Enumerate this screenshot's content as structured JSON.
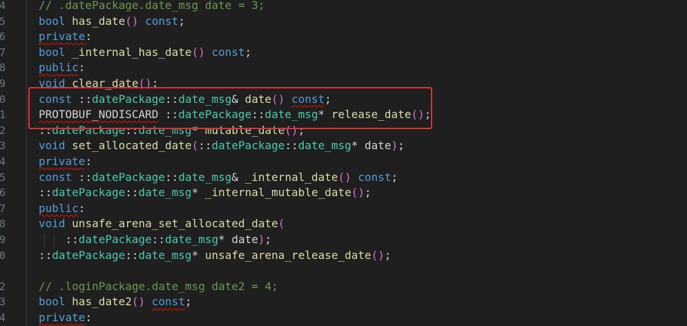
{
  "gutter": [
    "4",
    "5",
    "6",
    "7",
    "8",
    "9",
    "0",
    "1",
    "2",
    "3",
    "4",
    "5",
    "6",
    "7",
    "8",
    "9",
    "0",
    "",
    "2",
    "3",
    "4"
  ],
  "lines": [
    [
      {
        "c": "cm",
        "t": "// .datePackage.date_msg date = 3;"
      }
    ],
    [
      {
        "c": "kw",
        "t": "bool"
      },
      {
        "c": "pl",
        "t": " "
      },
      {
        "c": "fn",
        "t": "has_date"
      },
      {
        "c": "br",
        "t": "()"
      },
      {
        "c": "pl",
        "t": " "
      },
      {
        "c": "kw",
        "t": "const"
      },
      {
        "c": "pl",
        "t": ";"
      }
    ],
    [
      {
        "c": "kw sq",
        "t": "private"
      },
      {
        "c": "pl",
        "t": ":"
      }
    ],
    [
      {
        "c": "kw",
        "t": "bool"
      },
      {
        "c": "pl",
        "t": " "
      },
      {
        "c": "fn",
        "t": "_internal_has_date"
      },
      {
        "c": "br",
        "t": "()"
      },
      {
        "c": "pl",
        "t": " "
      },
      {
        "c": "kw",
        "t": "const"
      },
      {
        "c": "pl",
        "t": ";"
      }
    ],
    [
      {
        "c": "kw sq",
        "t": "public"
      },
      {
        "c": "pl",
        "t": ":"
      }
    ],
    [
      {
        "c": "kw",
        "t": "void"
      },
      {
        "c": "pl",
        "t": " "
      },
      {
        "c": "fn",
        "t": "clear_date"
      },
      {
        "c": "br",
        "t": "()"
      },
      {
        "c": "pl",
        "t": ";"
      }
    ],
    [
      {
        "c": "kw",
        "t": "const"
      },
      {
        "c": "pl",
        "t": " ::"
      },
      {
        "c": "ns",
        "t": "datePackage"
      },
      {
        "c": "pl",
        "t": "::"
      },
      {
        "c": "ns",
        "t": "date_msg"
      },
      {
        "c": "pl",
        "t": "& "
      },
      {
        "c": "fn",
        "t": "date"
      },
      {
        "c": "br",
        "t": "()"
      },
      {
        "c": "pl",
        "t": " "
      },
      {
        "c": "kw sq",
        "t": "const"
      },
      {
        "c": "pl",
        "t": ";"
      }
    ],
    [
      {
        "c": "mc sq",
        "t": "PROTOBUF_NODISCARD"
      },
      {
        "c": "pl",
        "t": " ::"
      },
      {
        "c": "ns",
        "t": "datePackage"
      },
      {
        "c": "pl",
        "t": "::"
      },
      {
        "c": "ns",
        "t": "date_msg"
      },
      {
        "c": "pl",
        "t": "* "
      },
      {
        "c": "fn",
        "t": "release_date"
      },
      {
        "c": "br",
        "t": "()"
      },
      {
        "c": "pl",
        "t": ";"
      }
    ],
    [
      {
        "c": "pl",
        "t": "::"
      },
      {
        "c": "ns",
        "t": "datePackage"
      },
      {
        "c": "pl",
        "t": "::"
      },
      {
        "c": "ns",
        "t": "date_msg"
      },
      {
        "c": "pl",
        "t": "* "
      },
      {
        "c": "fn",
        "t": "mutable_date"
      },
      {
        "c": "br",
        "t": "()"
      },
      {
        "c": "pl",
        "t": ";"
      }
    ],
    [
      {
        "c": "kw",
        "t": "void"
      },
      {
        "c": "pl",
        "t": " "
      },
      {
        "c": "fn",
        "t": "set_allocated_date"
      },
      {
        "c": "br",
        "t": "("
      },
      {
        "c": "pl",
        "t": "::"
      },
      {
        "c": "ns",
        "t": "datePackage"
      },
      {
        "c": "pl",
        "t": "::"
      },
      {
        "c": "ns",
        "t": "date_msg"
      },
      {
        "c": "pl",
        "t": "* date"
      },
      {
        "c": "br",
        "t": ")"
      },
      {
        "c": "pl",
        "t": ";"
      }
    ],
    [
      {
        "c": "kw sq",
        "t": "private"
      },
      {
        "c": "pl",
        "t": ":"
      }
    ],
    [
      {
        "c": "kw",
        "t": "const"
      },
      {
        "c": "pl",
        "t": " ::"
      },
      {
        "c": "ns",
        "t": "datePackage"
      },
      {
        "c": "pl",
        "t": "::"
      },
      {
        "c": "ns",
        "t": "date_msg"
      },
      {
        "c": "pl",
        "t": "& "
      },
      {
        "c": "fn",
        "t": "_internal_date"
      },
      {
        "c": "br",
        "t": "()"
      },
      {
        "c": "pl",
        "t": " "
      },
      {
        "c": "kw",
        "t": "const"
      },
      {
        "c": "pl",
        "t": ";"
      }
    ],
    [
      {
        "c": "pl",
        "t": "::"
      },
      {
        "c": "ns",
        "t": "datePackage"
      },
      {
        "c": "pl",
        "t": "::"
      },
      {
        "c": "ns",
        "t": "date_msg"
      },
      {
        "c": "pl",
        "t": "* "
      },
      {
        "c": "fn",
        "t": "_internal_mutable_date"
      },
      {
        "c": "br",
        "t": "()"
      },
      {
        "c": "pl",
        "t": ";"
      }
    ],
    [
      {
        "c": "kw sq",
        "t": "public"
      },
      {
        "c": "pl",
        "t": ":"
      }
    ],
    [
      {
        "c": "kw",
        "t": "void"
      },
      {
        "c": "pl",
        "t": " "
      },
      {
        "c": "fn",
        "t": "unsafe_arena_set_allocated_date"
      },
      {
        "c": "br",
        "t": "("
      }
    ],
    [
      {
        "c": "pl",
        "t": "    ::"
      },
      {
        "c": "ns",
        "t": "datePackage"
      },
      {
        "c": "pl",
        "t": "::"
      },
      {
        "c": "ns",
        "t": "date_msg"
      },
      {
        "c": "pl",
        "t": "* date"
      },
      {
        "c": "br",
        "t": ")"
      },
      {
        "c": "pl",
        "t": ";"
      }
    ],
    [
      {
        "c": "pl",
        "t": "::"
      },
      {
        "c": "ns",
        "t": "datePackage"
      },
      {
        "c": "pl",
        "t": "::"
      },
      {
        "c": "ns",
        "t": "date_msg"
      },
      {
        "c": "pl",
        "t": "* "
      },
      {
        "c": "fn",
        "t": "unsafe_arena_release_date"
      },
      {
        "c": "br",
        "t": "()"
      },
      {
        "c": "pl",
        "t": ";"
      }
    ],
    [],
    [
      {
        "c": "cm",
        "t": "// .loginPackage.date_msg date2 = 4;"
      }
    ],
    [
      {
        "c": "kw",
        "t": "bool"
      },
      {
        "c": "pl",
        "t": " "
      },
      {
        "c": "fn",
        "t": "has_date2"
      },
      {
        "c": "br",
        "t": "()"
      },
      {
        "c": "pl",
        "t": " "
      },
      {
        "c": "kw sq",
        "t": "const"
      },
      {
        "c": "pl",
        "t": ";"
      }
    ],
    [
      {
        "c": "kw sq",
        "t": "private"
      },
      {
        "c": "pl",
        "t": ":"
      }
    ]
  ],
  "colors": {
    "background": "#1f1f1f",
    "keyword": "#569cd6",
    "type": "#4ec9b0",
    "function": "#dcdcaa",
    "comment": "#6a9955",
    "bracket": "#da70d6",
    "highlight_box": "#e03030",
    "squiggle": "#e51400"
  }
}
